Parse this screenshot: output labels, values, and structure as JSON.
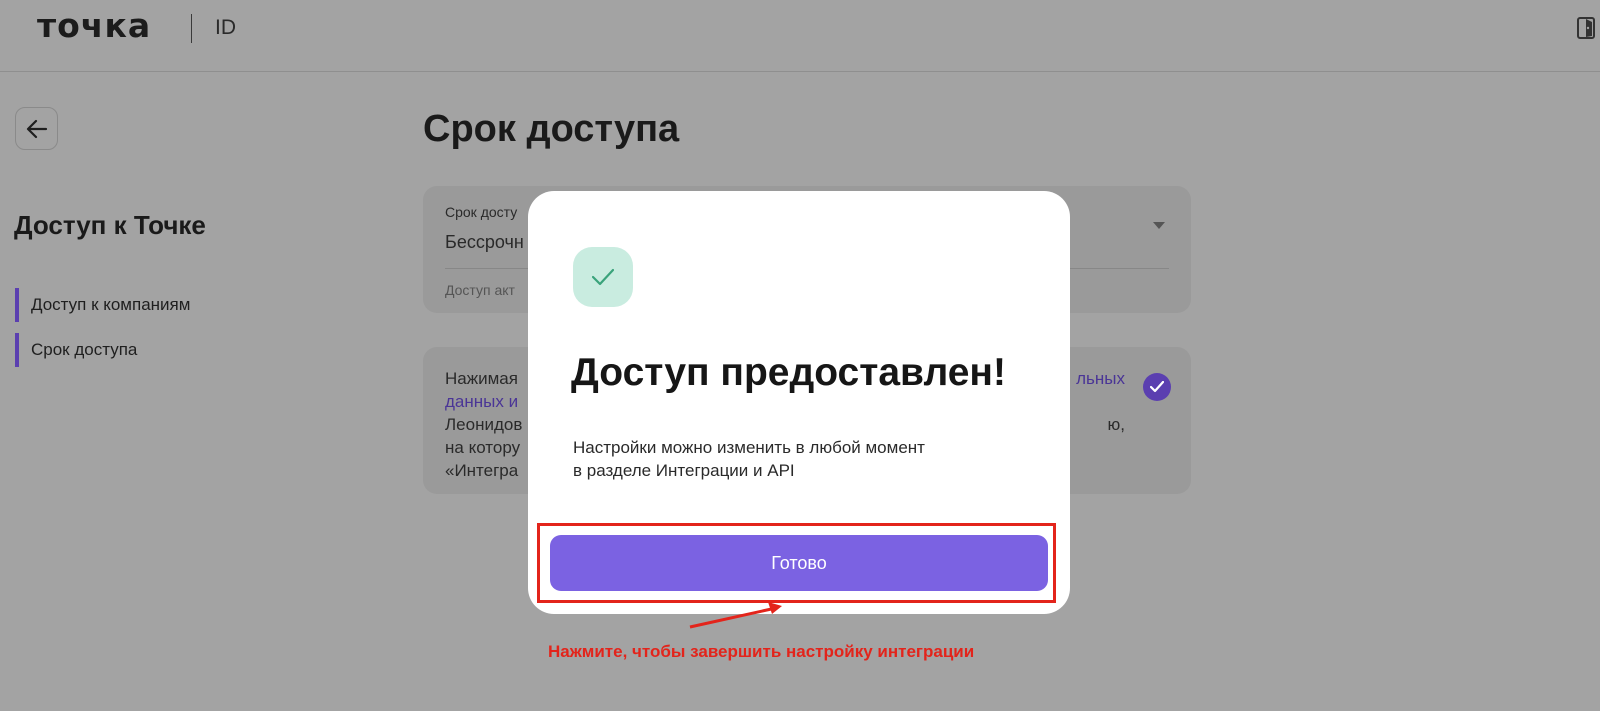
{
  "header": {
    "brand": "точка",
    "product": "ID"
  },
  "sidebar": {
    "title": "Доступ к Точке",
    "items": [
      {
        "label": "Доступ к компаниям"
      },
      {
        "label": "Срок доступа"
      }
    ]
  },
  "main": {
    "title": "Срок доступа",
    "access_field": {
      "label": "Срок досту",
      "value": "Бессрочн",
      "hint": "Доступ акт"
    },
    "consent": {
      "line1_start": "Нажимая",
      "line1_end": "льных",
      "line2_link": "данных и",
      "line3_start": "Леонидов",
      "line3_end": "ю,",
      "line4": "на котору",
      "line5": "«Интегра"
    }
  },
  "modal": {
    "title": "Доступ предоставлен!",
    "description_line1": "Настройки можно изменить в любой момент",
    "description_line2": "в разделе Интеграции и API",
    "done_button": "Готово"
  },
  "annotation": {
    "text": "Нажмите, чтобы завершить настройку интеграции",
    "color": "#e3241b"
  },
  "colors": {
    "accent": "#7b62e2",
    "nav_marker": "#5b3fb0",
    "success_badge": "#c9ece0",
    "success_check": "#3aa37b"
  }
}
